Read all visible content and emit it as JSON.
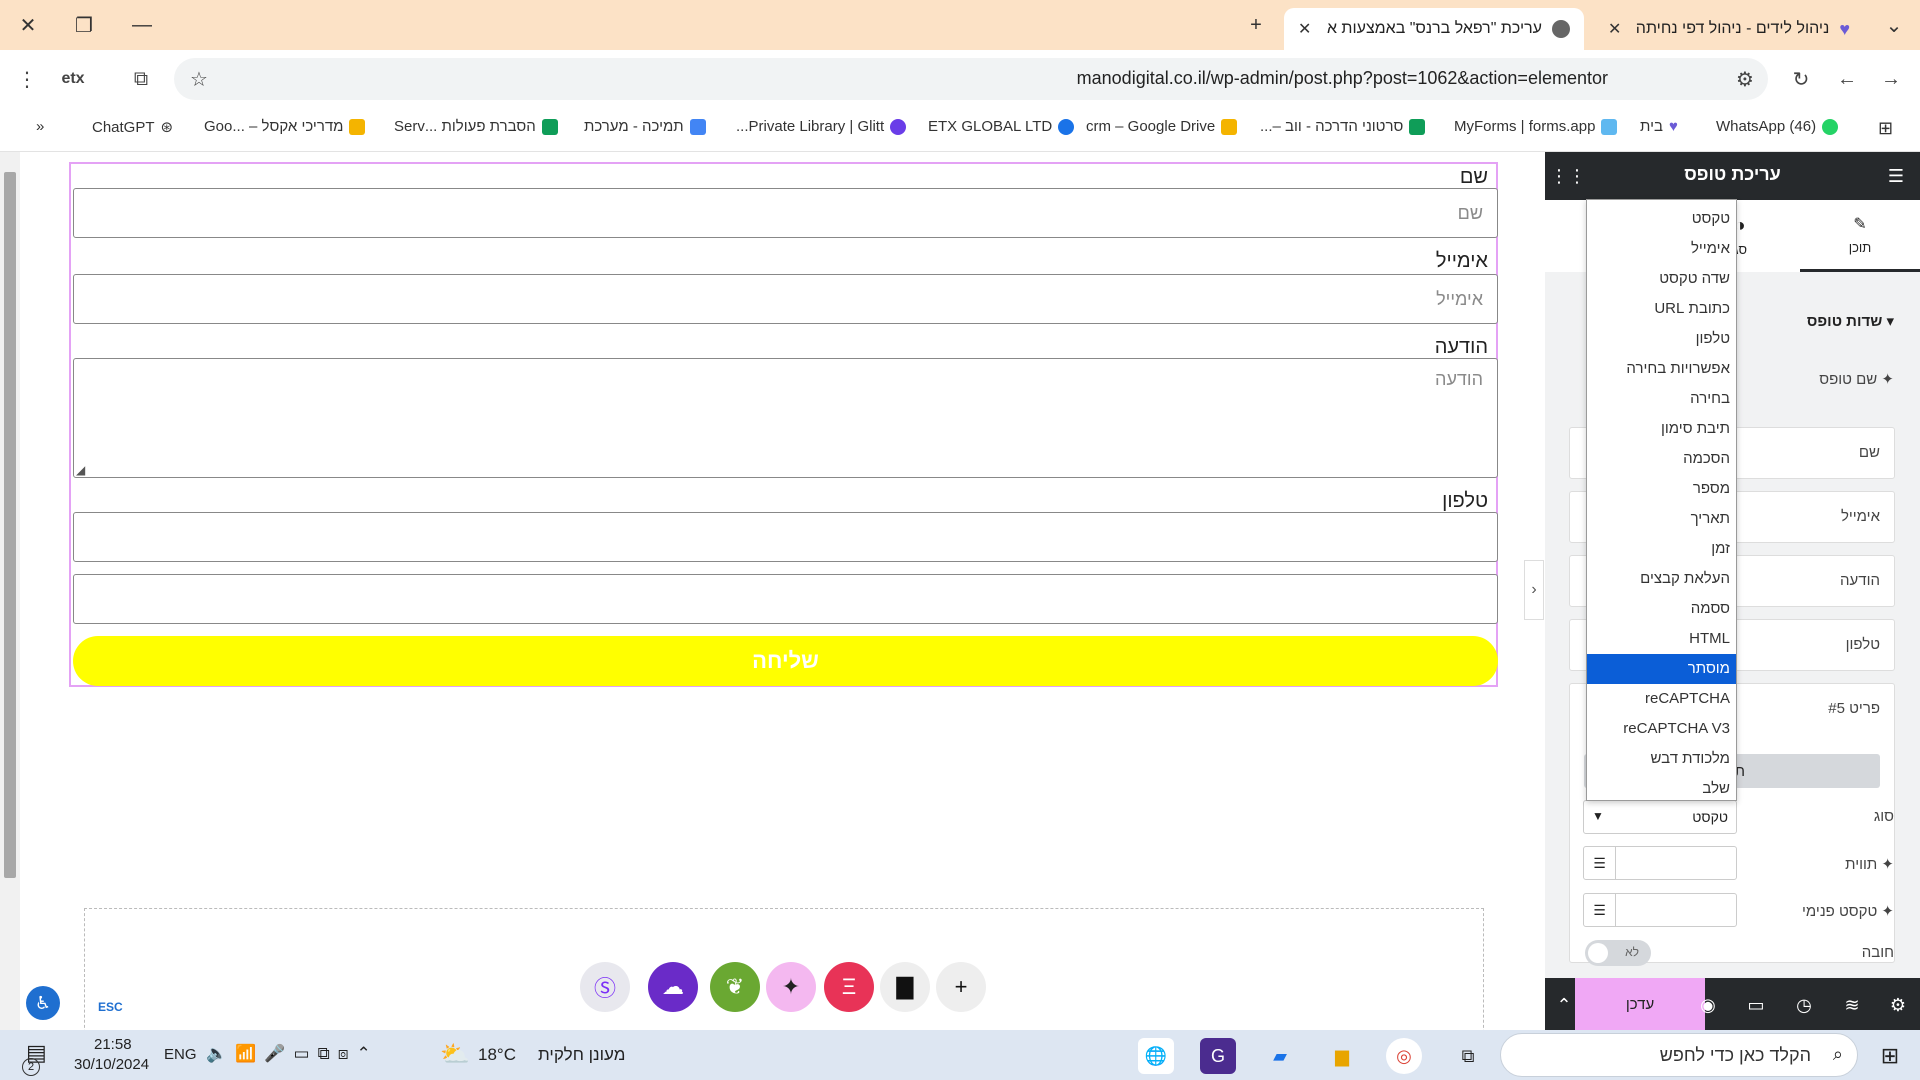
{
  "browser": {
    "tabs": [
      {
        "title": "ניהול לידים - ניהול דפי נחיתה",
        "active": false
      },
      {
        "title": "עריכת \"רפאל ברנס\" באמצעות א",
        "active": true
      }
    ],
    "url": "manodigital.co.il/wp-admin/post.php?post=1062&action=elementor",
    "bookmarks": [
      "(46) WhatsApp",
      "בית",
      "MyForms | forms.app",
      "סרטוני הדרכה - ווב –...",
      "crm – Google Drive",
      "ETX GLOBAL LTD",
      "Private Library | Glitt...",
      "תמיכה - מערכת",
      "הסברת פעולות ...Serv",
      "מדריכי אקסל – ...Goo",
      "ChatGPT"
    ]
  },
  "form": {
    "fields": [
      {
        "label": "שם",
        "placeholder": "שם"
      },
      {
        "label": "אימייל",
        "placeholder": "אימייל"
      },
      {
        "label": "הודעה",
        "placeholder": "הודעה"
      },
      {
        "label": "טלפון",
        "placeholder": ""
      }
    ],
    "submit": "שליחה"
  },
  "esc": "ESC",
  "panel": {
    "title": "עריכת טופס",
    "tab_content": "תוכן",
    "tab_style": "סג",
    "section": "שדות טופס",
    "form_name_label": "שם טופס",
    "items": [
      "שם",
      "אימייל",
      "הודעה",
      "טלפון",
      "פריט #5"
    ],
    "inner_tab": "תוכן",
    "type_label": "סוג",
    "type_value": "טקסט",
    "label_label": "תווית",
    "placeholder_label": "טקסט פנימי",
    "required_label": "חובה",
    "required_value": "לא",
    "update": "עדכן"
  },
  "dropdown": {
    "options": [
      "טקסט",
      "אימייל",
      "שדה טקסט",
      "כתובת URL",
      "טלפון",
      "אפשרויות בחירה",
      "בחירה",
      "תיבת סימון",
      "הסכמה",
      "מספר",
      "תאריך",
      "זמן",
      "העלאת קבצים",
      "ססמה",
      "HTML",
      "מוסתר",
      "reCAPTCHA",
      "reCAPTCHA V3",
      "מלכודת דבש",
      "שלב"
    ],
    "selected_index": 15
  },
  "taskbar": {
    "search_placeholder": "הקלד כאן כדי לחפש",
    "weather": "מעונן חלקית",
    "temp": "18°C",
    "lang": "ENG",
    "time": "21:58",
    "date": "30/10/2024",
    "notif_count": "2"
  }
}
